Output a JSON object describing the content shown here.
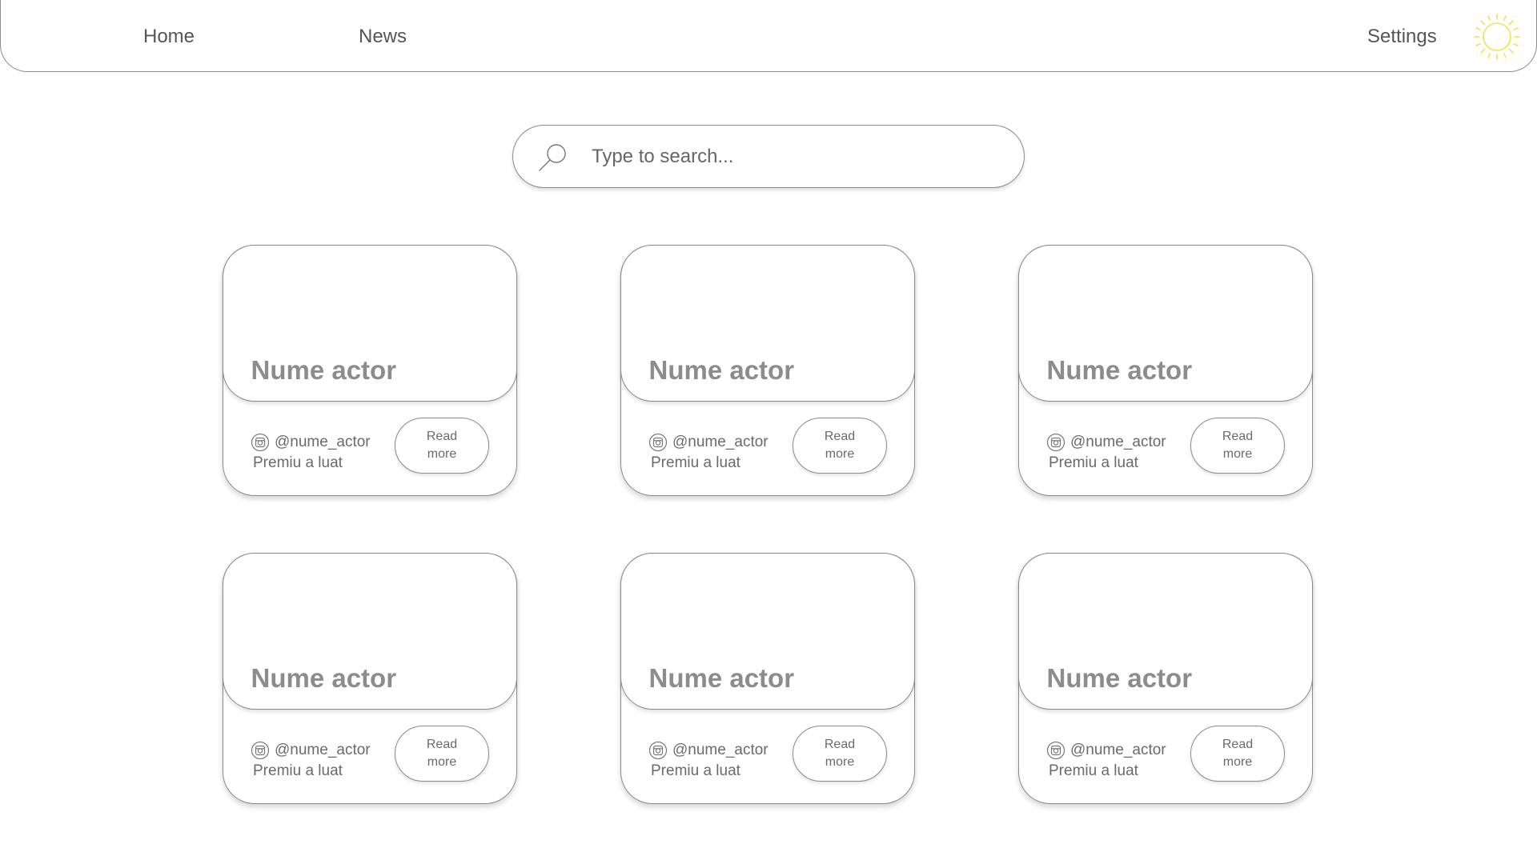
{
  "nav": {
    "home_label": "Home",
    "news_label": "News",
    "settings_label": "Settings",
    "theme_icon": "sun-icon",
    "theme_icon_color": "#f2e14f"
  },
  "search": {
    "placeholder": "Type to search...",
    "value": "",
    "icon": "search-icon"
  },
  "cards": [
    {
      "name": "Nume actor",
      "handle": "@nume_actor",
      "award": "Premiu a luat",
      "button_label": "Read more",
      "social_icon": "instagram-icon"
    },
    {
      "name": "Nume actor",
      "handle": "@nume_actor",
      "award": "Premiu a luat",
      "button_label": "Read more",
      "social_icon": "instagram-icon"
    },
    {
      "name": "Nume actor",
      "handle": "@nume_actor",
      "award": "Premiu a luat",
      "button_label": "Read more",
      "social_icon": "instagram-icon"
    },
    {
      "name": "Nume actor",
      "handle": "@nume_actor",
      "award": "Premiu a luat",
      "button_label": "Read more",
      "social_icon": "instagram-icon"
    },
    {
      "name": "Nume actor",
      "handle": "@nume_actor",
      "award": "Premiu a luat",
      "button_label": "Read more",
      "social_icon": "instagram-icon"
    },
    {
      "name": "Nume actor",
      "handle": "@nume_actor",
      "award": "Premiu a luat",
      "button_label": "Read more",
      "social_icon": "instagram-icon"
    }
  ]
}
